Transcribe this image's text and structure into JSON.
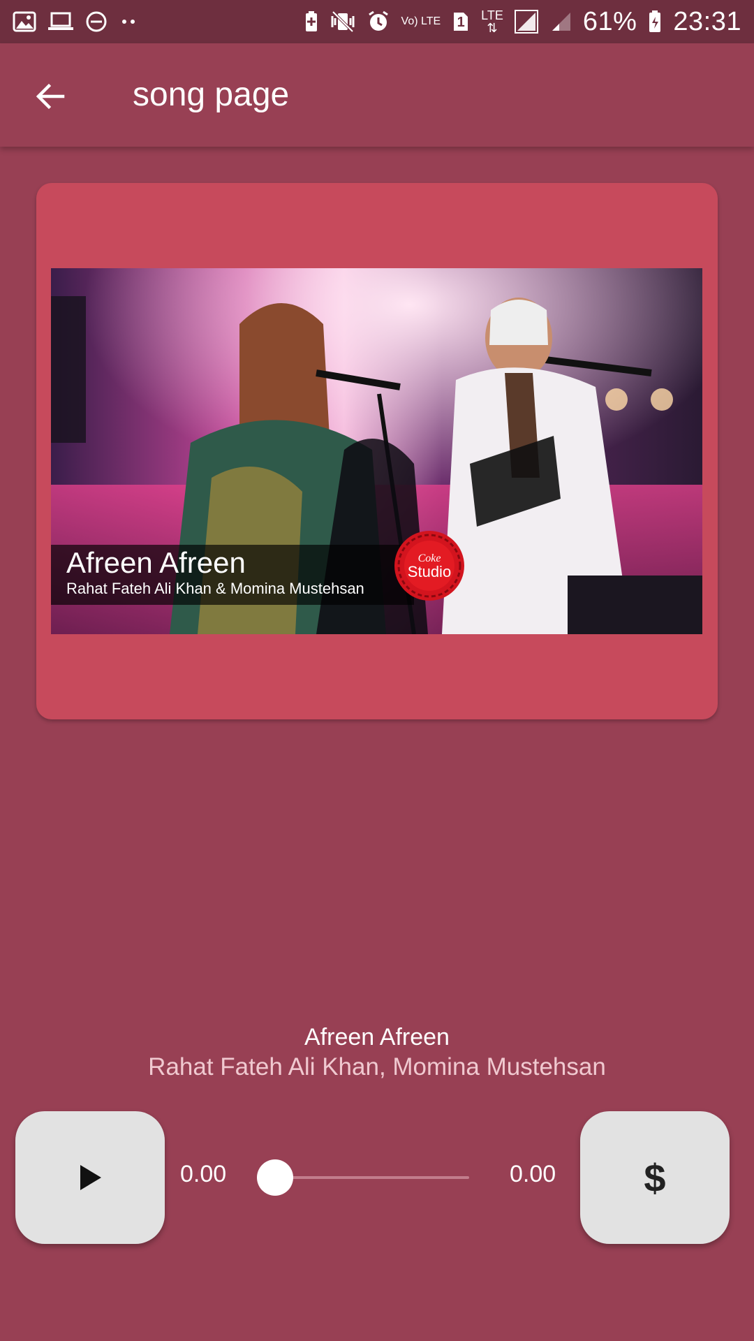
{
  "status_bar": {
    "battery_percent": "61%",
    "time": "23:31",
    "left_icons": [
      "image-icon",
      "laptop-icon",
      "do-not-disturb-icon",
      "more-dots-icon"
    ],
    "right_icons": [
      "battery-saver-icon",
      "vibrate-icon",
      "alarm-icon",
      "volte-icon",
      "sim-1-icon",
      "lte-signal-icon",
      "signal-icon",
      "battery-icon"
    ],
    "labels": {
      "volte": "Vo) LTE",
      "sim": "1",
      "lte": "LTE"
    }
  },
  "app_bar": {
    "title": "song page",
    "back_icon": "arrow-back-icon"
  },
  "album_card": {
    "cover_title": "Afreen Afreen",
    "cover_subtitle": "Rahat Fateh Ali Khan & Momina Mustehsan",
    "logo_text_top": "Coke",
    "logo_text_bottom": "Studio",
    "bg_color": "#c74a5c"
  },
  "now_playing": {
    "title": "Afreen Afreen",
    "artists": "Rahat Fateh Ali Khan, Momina Mustehsan"
  },
  "controls": {
    "play_icon": "play-icon",
    "elapsed": "0.00",
    "duration": "0.00",
    "progress": 0,
    "action_label": "$"
  },
  "colors": {
    "background": "#984054",
    "status_bar": "#6e2f3f",
    "card": "#c74a5c",
    "button": "#e2e2e2"
  }
}
